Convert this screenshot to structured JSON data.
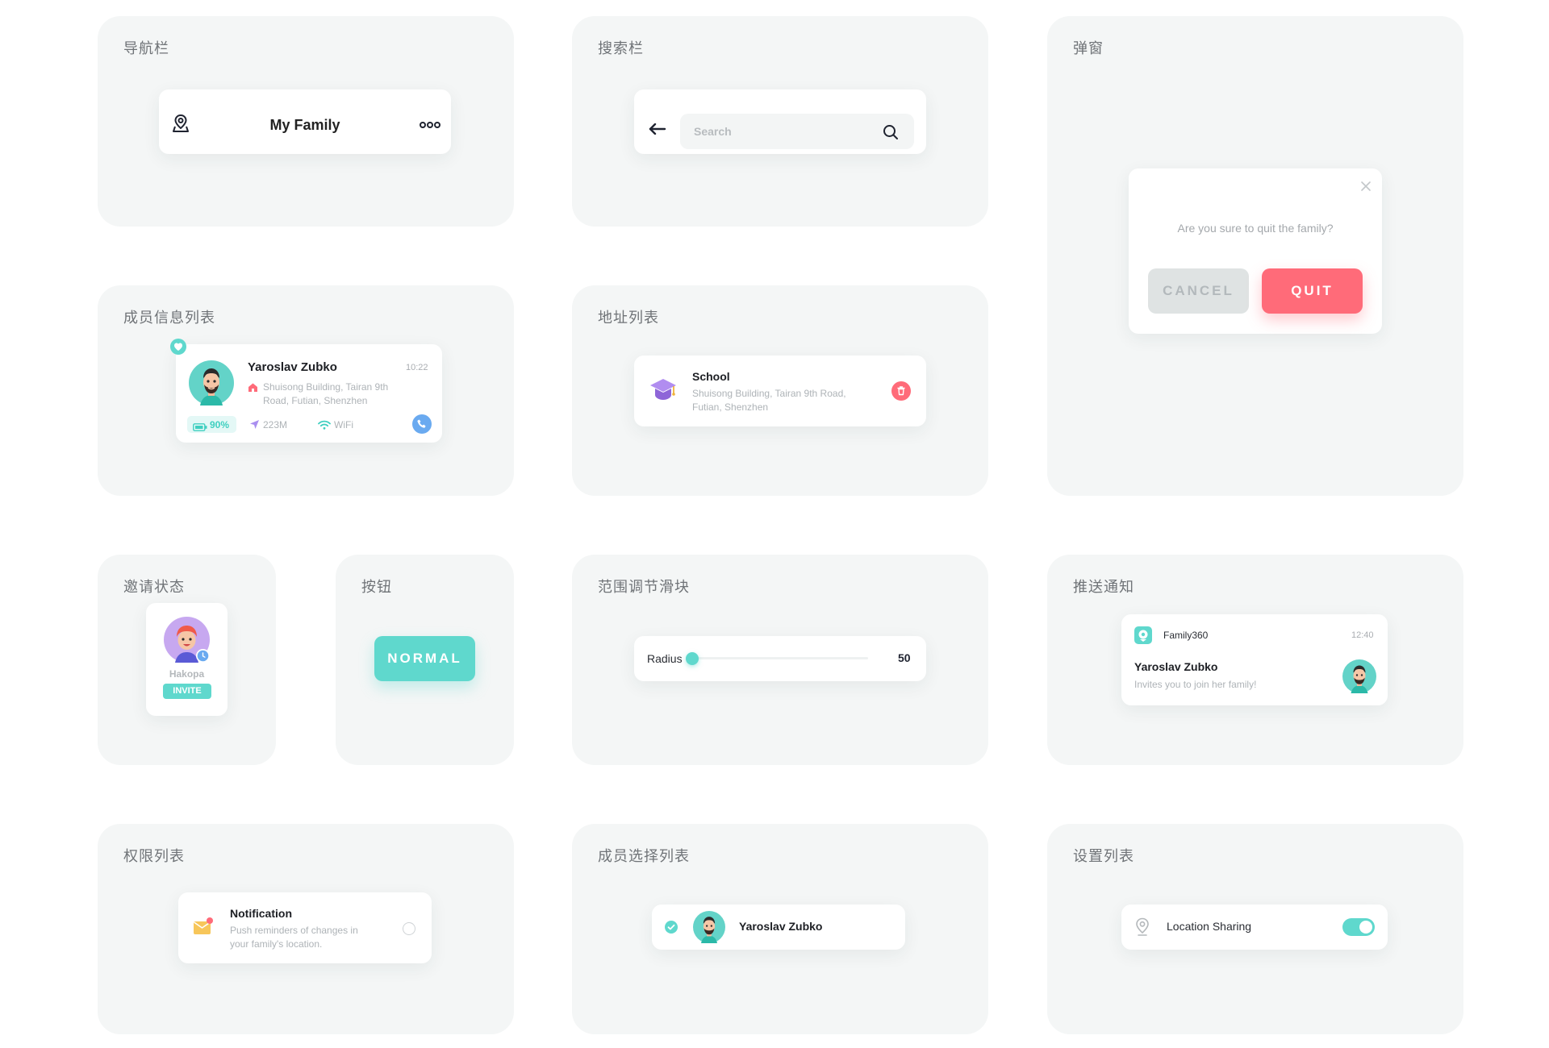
{
  "panels": {
    "nav": "导航栏",
    "search": "搜索栏",
    "dialog": "弹窗",
    "member_info": "成员信息列表",
    "address": "地址列表",
    "invite": "邀请状态",
    "button": "按钮",
    "slider": "范围调节滑块",
    "push": "推送通知",
    "permission": "权限列表",
    "member_select": "成员选择列表",
    "settings": "设置列表"
  },
  "nav": {
    "title": "My Family"
  },
  "search": {
    "placeholder": "Search"
  },
  "dialog": {
    "question": "Are you sure to quit the family?",
    "cancel": "CANCEL",
    "quit": "QUIT"
  },
  "member_info": {
    "name": "Yaroslav Zubko",
    "time": "10:22",
    "address_line1": "Shuisong Building, Tairan 9th",
    "address_line2": "Road, Futian, Shenzhen",
    "battery": "90%",
    "distance": "223M",
    "network": "WiFi"
  },
  "address": {
    "name": "School",
    "line1": "Shuisong Building, Tairan 9th Road,",
    "line2": "Futian, Shenzhen"
  },
  "invite": {
    "name": "Hakopa",
    "status": "INVITE"
  },
  "button": {
    "label": "NORMAL"
  },
  "slider": {
    "label": "Radius",
    "value": "50",
    "fraction": 0.0
  },
  "push": {
    "app": "Family360",
    "time": "12:40",
    "name": "Yaroslav Zubko",
    "message": "Invites you to join her family!"
  },
  "permission": {
    "title": "Notification",
    "line1": "Push reminders of changes in",
    "line2": "your family's location."
  },
  "member_select": {
    "name": "Yaroslav Zubko",
    "selected": true
  },
  "settings": {
    "label": "Location Sharing",
    "enabled": true
  },
  "colors": {
    "accent": "#5fd8cd",
    "danger": "#ff6b79",
    "panel_bg": "#f4f6f6",
    "cancel_bg": "#dfe3e3",
    "call_blue": "#6aaaf0"
  }
}
